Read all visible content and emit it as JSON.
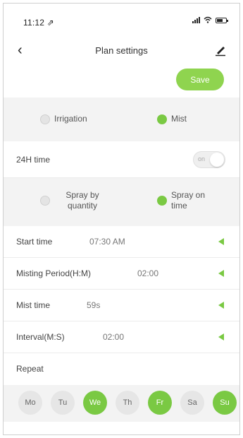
{
  "status_bar": {
    "time": "11:12 ⇗"
  },
  "header": {
    "title": "Plan settings",
    "back_icon": "‹",
    "edit_icon": "pen-icon"
  },
  "toolbar": {
    "save_label": "Save"
  },
  "mode": {
    "options": [
      {
        "label": "Irrigation",
        "selected": false
      },
      {
        "label": "Mist",
        "selected": true
      }
    ]
  },
  "time_format": {
    "label": "24H time",
    "toggle_text": "on",
    "enabled": false
  },
  "spray": {
    "options": [
      {
        "label": "Spray by quantity",
        "selected": false
      },
      {
        "label": "Spray on time",
        "selected": true
      }
    ]
  },
  "fields": {
    "start_time": {
      "label": "Start time",
      "value": "07:30 AM"
    },
    "misting_period": {
      "label": "Misting Period(H:M)",
      "value": "02:00"
    },
    "mist_time": {
      "label": "Mist time",
      "value": "59s"
    },
    "interval": {
      "label": "Interval(M:S)",
      "value": "02:00"
    }
  },
  "repeat": {
    "label": "Repeat",
    "days": [
      {
        "label": "Mo",
        "selected": false
      },
      {
        "label": "Tu",
        "selected": false
      },
      {
        "label": "We",
        "selected": true
      },
      {
        "label": "Th",
        "selected": false
      },
      {
        "label": "Fr",
        "selected": true
      },
      {
        "label": "Sa",
        "selected": false
      },
      {
        "label": "Su",
        "selected": true
      }
    ]
  },
  "colors": {
    "accent": "#7ac943",
    "save_button": "#8fd44f",
    "band_background": "#f3f3f3"
  }
}
